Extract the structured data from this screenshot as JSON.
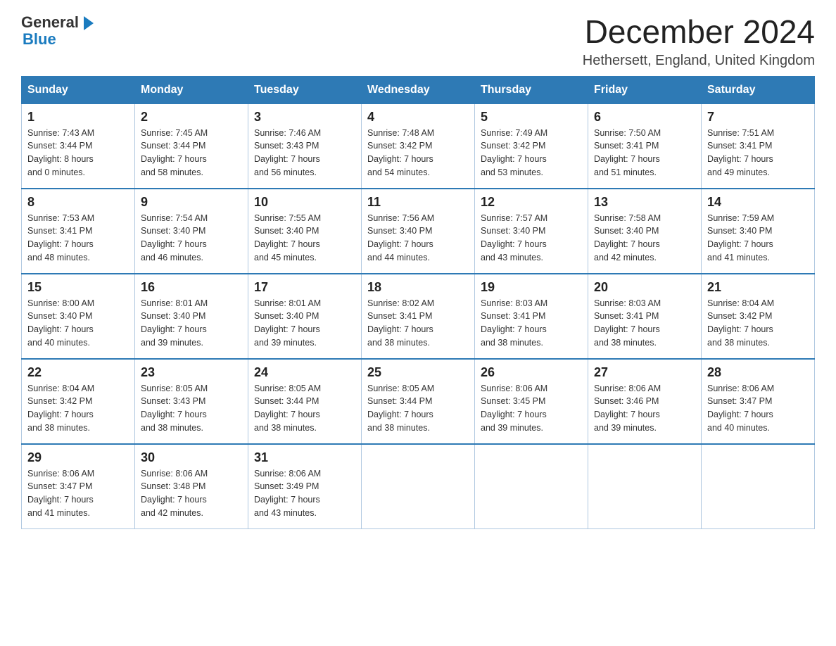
{
  "header": {
    "logo_general": "General",
    "logo_blue": "Blue",
    "month_title": "December 2024",
    "location": "Hethersett, England, United Kingdom"
  },
  "days_of_week": [
    "Sunday",
    "Monday",
    "Tuesday",
    "Wednesday",
    "Thursday",
    "Friday",
    "Saturday"
  ],
  "weeks": [
    [
      {
        "date": "1",
        "sunrise": "Sunrise: 7:43 AM",
        "sunset": "Sunset: 3:44 PM",
        "daylight": "Daylight: 8 hours",
        "minutes": "and 0 minutes."
      },
      {
        "date": "2",
        "sunrise": "Sunrise: 7:45 AM",
        "sunset": "Sunset: 3:44 PM",
        "daylight": "Daylight: 7 hours",
        "minutes": "and 58 minutes."
      },
      {
        "date": "3",
        "sunrise": "Sunrise: 7:46 AM",
        "sunset": "Sunset: 3:43 PM",
        "daylight": "Daylight: 7 hours",
        "minutes": "and 56 minutes."
      },
      {
        "date": "4",
        "sunrise": "Sunrise: 7:48 AM",
        "sunset": "Sunset: 3:42 PM",
        "daylight": "Daylight: 7 hours",
        "minutes": "and 54 minutes."
      },
      {
        "date": "5",
        "sunrise": "Sunrise: 7:49 AM",
        "sunset": "Sunset: 3:42 PM",
        "daylight": "Daylight: 7 hours",
        "minutes": "and 53 minutes."
      },
      {
        "date": "6",
        "sunrise": "Sunrise: 7:50 AM",
        "sunset": "Sunset: 3:41 PM",
        "daylight": "Daylight: 7 hours",
        "minutes": "and 51 minutes."
      },
      {
        "date": "7",
        "sunrise": "Sunrise: 7:51 AM",
        "sunset": "Sunset: 3:41 PM",
        "daylight": "Daylight: 7 hours",
        "minutes": "and 49 minutes."
      }
    ],
    [
      {
        "date": "8",
        "sunrise": "Sunrise: 7:53 AM",
        "sunset": "Sunset: 3:41 PM",
        "daylight": "Daylight: 7 hours",
        "minutes": "and 48 minutes."
      },
      {
        "date": "9",
        "sunrise": "Sunrise: 7:54 AM",
        "sunset": "Sunset: 3:40 PM",
        "daylight": "Daylight: 7 hours",
        "minutes": "and 46 minutes."
      },
      {
        "date": "10",
        "sunrise": "Sunrise: 7:55 AM",
        "sunset": "Sunset: 3:40 PM",
        "daylight": "Daylight: 7 hours",
        "minutes": "and 45 minutes."
      },
      {
        "date": "11",
        "sunrise": "Sunrise: 7:56 AM",
        "sunset": "Sunset: 3:40 PM",
        "daylight": "Daylight: 7 hours",
        "minutes": "and 44 minutes."
      },
      {
        "date": "12",
        "sunrise": "Sunrise: 7:57 AM",
        "sunset": "Sunset: 3:40 PM",
        "daylight": "Daylight: 7 hours",
        "minutes": "and 43 minutes."
      },
      {
        "date": "13",
        "sunrise": "Sunrise: 7:58 AM",
        "sunset": "Sunset: 3:40 PM",
        "daylight": "Daylight: 7 hours",
        "minutes": "and 42 minutes."
      },
      {
        "date": "14",
        "sunrise": "Sunrise: 7:59 AM",
        "sunset": "Sunset: 3:40 PM",
        "daylight": "Daylight: 7 hours",
        "minutes": "and 41 minutes."
      }
    ],
    [
      {
        "date": "15",
        "sunrise": "Sunrise: 8:00 AM",
        "sunset": "Sunset: 3:40 PM",
        "daylight": "Daylight: 7 hours",
        "minutes": "and 40 minutes."
      },
      {
        "date": "16",
        "sunrise": "Sunrise: 8:01 AM",
        "sunset": "Sunset: 3:40 PM",
        "daylight": "Daylight: 7 hours",
        "minutes": "and 39 minutes."
      },
      {
        "date": "17",
        "sunrise": "Sunrise: 8:01 AM",
        "sunset": "Sunset: 3:40 PM",
        "daylight": "Daylight: 7 hours",
        "minutes": "and 39 minutes."
      },
      {
        "date": "18",
        "sunrise": "Sunrise: 8:02 AM",
        "sunset": "Sunset: 3:41 PM",
        "daylight": "Daylight: 7 hours",
        "minutes": "and 38 minutes."
      },
      {
        "date": "19",
        "sunrise": "Sunrise: 8:03 AM",
        "sunset": "Sunset: 3:41 PM",
        "daylight": "Daylight: 7 hours",
        "minutes": "and 38 minutes."
      },
      {
        "date": "20",
        "sunrise": "Sunrise: 8:03 AM",
        "sunset": "Sunset: 3:41 PM",
        "daylight": "Daylight: 7 hours",
        "minutes": "and 38 minutes."
      },
      {
        "date": "21",
        "sunrise": "Sunrise: 8:04 AM",
        "sunset": "Sunset: 3:42 PM",
        "daylight": "Daylight: 7 hours",
        "minutes": "and 38 minutes."
      }
    ],
    [
      {
        "date": "22",
        "sunrise": "Sunrise: 8:04 AM",
        "sunset": "Sunset: 3:42 PM",
        "daylight": "Daylight: 7 hours",
        "minutes": "and 38 minutes."
      },
      {
        "date": "23",
        "sunrise": "Sunrise: 8:05 AM",
        "sunset": "Sunset: 3:43 PM",
        "daylight": "Daylight: 7 hours",
        "minutes": "and 38 minutes."
      },
      {
        "date": "24",
        "sunrise": "Sunrise: 8:05 AM",
        "sunset": "Sunset: 3:44 PM",
        "daylight": "Daylight: 7 hours",
        "minutes": "and 38 minutes."
      },
      {
        "date": "25",
        "sunrise": "Sunrise: 8:05 AM",
        "sunset": "Sunset: 3:44 PM",
        "daylight": "Daylight: 7 hours",
        "minutes": "and 38 minutes."
      },
      {
        "date": "26",
        "sunrise": "Sunrise: 8:06 AM",
        "sunset": "Sunset: 3:45 PM",
        "daylight": "Daylight: 7 hours",
        "minutes": "and 39 minutes."
      },
      {
        "date": "27",
        "sunrise": "Sunrise: 8:06 AM",
        "sunset": "Sunset: 3:46 PM",
        "daylight": "Daylight: 7 hours",
        "minutes": "and 39 minutes."
      },
      {
        "date": "28",
        "sunrise": "Sunrise: 8:06 AM",
        "sunset": "Sunset: 3:47 PM",
        "daylight": "Daylight: 7 hours",
        "minutes": "and 40 minutes."
      }
    ],
    [
      {
        "date": "29",
        "sunrise": "Sunrise: 8:06 AM",
        "sunset": "Sunset: 3:47 PM",
        "daylight": "Daylight: 7 hours",
        "minutes": "and 41 minutes."
      },
      {
        "date": "30",
        "sunrise": "Sunrise: 8:06 AM",
        "sunset": "Sunset: 3:48 PM",
        "daylight": "Daylight: 7 hours",
        "minutes": "and 42 minutes."
      },
      {
        "date": "31",
        "sunrise": "Sunrise: 8:06 AM",
        "sunset": "Sunset: 3:49 PM",
        "daylight": "Daylight: 7 hours",
        "minutes": "and 43 minutes."
      },
      null,
      null,
      null,
      null
    ]
  ]
}
